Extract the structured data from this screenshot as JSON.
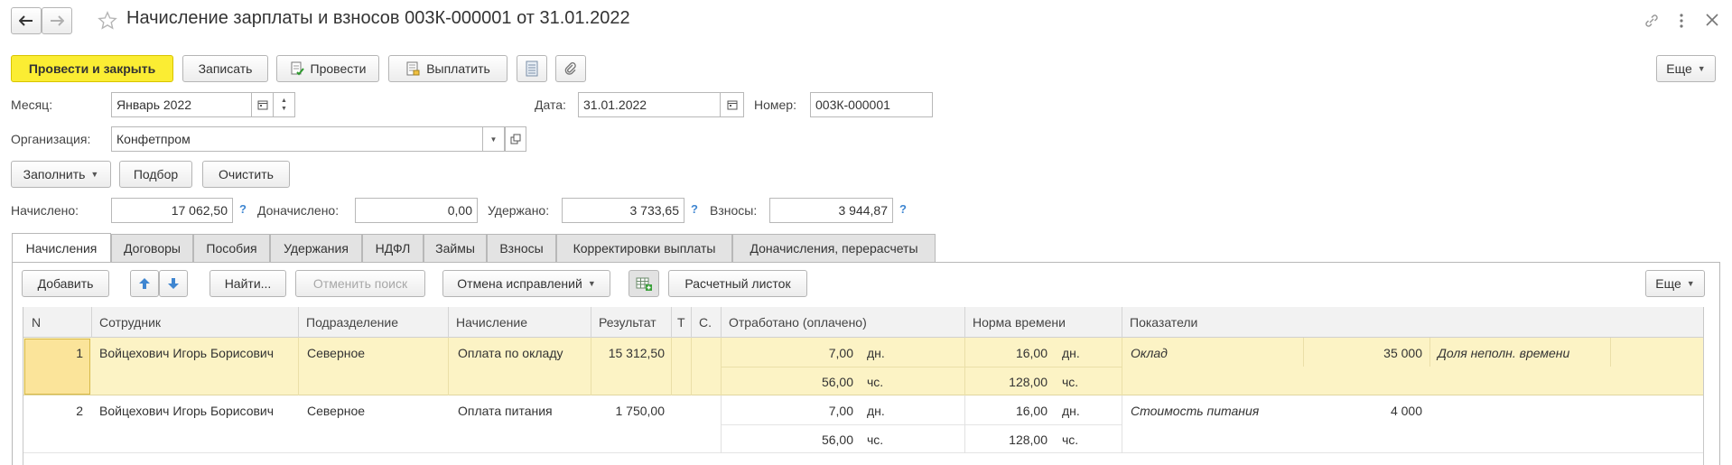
{
  "title": "Начисление зарплаты и взносов 003К-000001 от 31.01.2022",
  "toolbar": {
    "post_close": "Провести и закрыть",
    "save": "Записать",
    "post": "Провести",
    "pay": "Выплатить",
    "more": "Еще"
  },
  "fields": {
    "month_label": "Месяц:",
    "month_value": "Январь 2022",
    "date_label": "Дата:",
    "date_value": "31.01.2022",
    "number_label": "Номер:",
    "number_value": "003К-000001",
    "org_label": "Организация:",
    "org_value": "Конфетпром"
  },
  "actions": {
    "fill": "Заполнить",
    "select": "Подбор",
    "clear": "Очистить"
  },
  "totals": {
    "accrued_label": "Начислено:",
    "accrued_value": "17 062,50",
    "extra_label": "Доначислено:",
    "extra_value": "0,00",
    "withheld_label": "Удержано:",
    "withheld_value": "3 733,65",
    "contrib_label": "Взносы:",
    "contrib_value": "3 944,87",
    "help": "?"
  },
  "tabs": [
    "Начисления",
    "Договоры",
    "Пособия",
    "Удержания",
    "НДФЛ",
    "Займы",
    "Взносы",
    "Корректировки выплаты",
    "Доначисления, перерасчеты"
  ],
  "grid_toolbar": {
    "add": "Добавить",
    "find": "Найти...",
    "cancel_search": "Отменить поиск",
    "cancel_fix": "Отмена исправлений",
    "payslip": "Расчетный листок",
    "more": "Еще"
  },
  "columns": {
    "n": "N",
    "employee": "Сотрудник",
    "department": "Подразделение",
    "accrual": "Начисление",
    "result": "Результат",
    "t": "Т",
    "s": "С.",
    "worked": "Отработано (оплачено)",
    "norm": "Норма времени",
    "indicators": "Показатели"
  },
  "rows": [
    {
      "n": "1",
      "employee": "Войцехович Игорь Борисович",
      "department": "Северное",
      "accrual": "Оплата по окладу",
      "result": "15 312,50",
      "worked_days": "7,00",
      "days_unit": "дн.",
      "worked_hours": "56,00",
      "hours_unit": "чс.",
      "norm_days": "16,00",
      "norm_hours": "128,00",
      "ind1_name": "Оклад",
      "ind1_value": "35 000",
      "ind2_name": "Доля неполн. времени"
    },
    {
      "n": "2",
      "employee": "Войцехович Игорь Борисович",
      "department": "Северное",
      "accrual": "Оплата питания",
      "result": "1 750,00",
      "worked_days": "7,00",
      "days_unit": "дн.",
      "worked_hours": "56,00",
      "hours_unit": "чс.",
      "norm_days": "16,00",
      "norm_hours": "128,00",
      "ind1_name": "Стоимость питания",
      "ind1_value": "4 000"
    }
  ],
  "colors": {
    "primary": "#fbed33",
    "selected_row": "#fcf3c5",
    "help": "#3f86d1"
  }
}
